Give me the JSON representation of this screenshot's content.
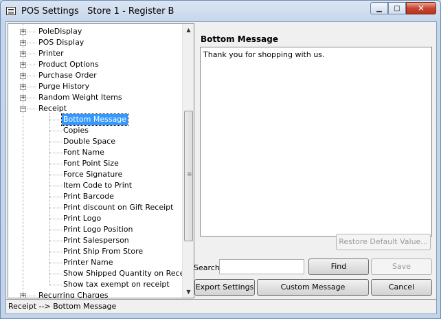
{
  "window": {
    "title": "POS Settings   Store 1 - Register B",
    "minimize_icon": "minimize-icon",
    "maximize_icon": "maximize-icon",
    "close_icon": "close-icon"
  },
  "tree": {
    "parents_before": [
      "PoleDisplay",
      "POS Display",
      "Printer",
      "Product Options",
      "Purchase Order",
      "Purge History",
      "Random Weight Items"
    ],
    "expanded_parent": "Receipt",
    "children": [
      "Bottom Message",
      "Copies",
      "Double Space",
      "Font Name",
      "Font Point Size",
      "Force Signature",
      "Item Code to Print",
      "Print Barcode",
      "Print discount on Gift Receipt",
      "Print Logo",
      "Print Logo Position",
      "Print Salesperson",
      "Print Ship From Store",
      "Printer Name",
      "Show Shipped Quantity on Receipt",
      "Show tax exempt on receipt"
    ],
    "selected_child": "Bottom Message",
    "parents_after": [
      "Recurring Charges"
    ]
  },
  "panel": {
    "title": "Bottom Message",
    "message": "Thank you for shopping with us.",
    "restore_default_label": "Restore Default Value..."
  },
  "search": {
    "label": "Search",
    "value": "",
    "find_label": "Find",
    "save_label": "Save"
  },
  "footer_buttons": {
    "export_label": "Export Settings",
    "custom_message_label": "Custom Message",
    "cancel_label": "Cancel"
  },
  "status": {
    "text": "Receipt  -->  Bottom Message"
  }
}
